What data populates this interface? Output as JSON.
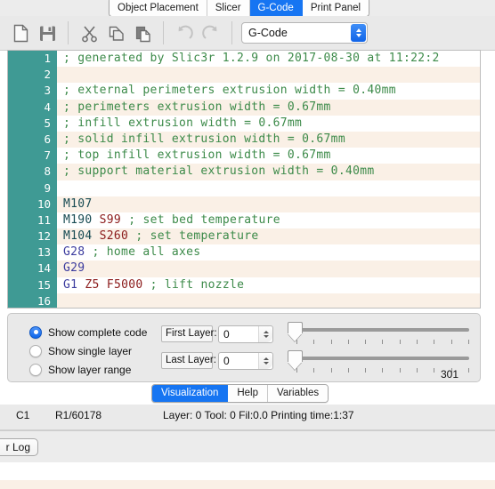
{
  "top_tabs": [
    {
      "label": "Object Placement",
      "active": false
    },
    {
      "label": "Slicer",
      "active": false
    },
    {
      "label": "G-Code",
      "active": true
    },
    {
      "label": "Print Panel",
      "active": false
    }
  ],
  "toolbar": {
    "icons": [
      {
        "name": "new-file-icon",
        "title": "New"
      },
      {
        "name": "save-icon",
        "title": "Save"
      },
      {
        "name": "cut-icon",
        "title": "Cut"
      },
      {
        "name": "copy-icon",
        "title": "Copy"
      },
      {
        "name": "paste-icon",
        "title": "Paste"
      },
      {
        "name": "undo-icon",
        "title": "Undo"
      },
      {
        "name": "redo-icon",
        "title": "Redo"
      }
    ],
    "combo_value": "G-Code",
    "combo_options": [
      "G-Code"
    ]
  },
  "editor": {
    "lines": [
      {
        "num": "1",
        "segments": [
          {
            "t": "; generated by Slic3r 1.2.9 on 2017-08-30 at 11:22:2",
            "c": "cmt"
          }
        ]
      },
      {
        "num": "2",
        "segments": []
      },
      {
        "num": "3",
        "segments": [
          {
            "t": "; external perimeters extrusion width = 0.40mm",
            "c": "cmt"
          }
        ]
      },
      {
        "num": "4",
        "segments": [
          {
            "t": "; perimeters extrusion width = 0.67mm",
            "c": "cmt"
          }
        ]
      },
      {
        "num": "5",
        "segments": [
          {
            "t": "; infill extrusion width = 0.67mm",
            "c": "cmt"
          }
        ]
      },
      {
        "num": "6",
        "segments": [
          {
            "t": "; solid infill extrusion width = 0.67mm",
            "c": "cmt"
          }
        ]
      },
      {
        "num": "7",
        "segments": [
          {
            "t": "; top infill extrusion width = 0.67mm",
            "c": "cmt"
          }
        ]
      },
      {
        "num": "8",
        "segments": [
          {
            "t": "; support material extrusion width = 0.40mm",
            "c": "cmt"
          }
        ]
      },
      {
        "num": "9",
        "segments": []
      },
      {
        "num": "10",
        "segments": [
          {
            "t": "M107",
            "c": "mcmd"
          }
        ]
      },
      {
        "num": "11",
        "segments": [
          {
            "t": "M190",
            "c": "mcmd"
          },
          {
            "t": " ",
            "c": "plain"
          },
          {
            "t": "S99",
            "c": "par"
          },
          {
            "t": " ",
            "c": "plain"
          },
          {
            "t": "; set bed temperature",
            "c": "cmt"
          }
        ]
      },
      {
        "num": "12",
        "segments": [
          {
            "t": "M104",
            "c": "mcmd"
          },
          {
            "t": " ",
            "c": "plain"
          },
          {
            "t": "S260",
            "c": "par"
          },
          {
            "t": " ",
            "c": "plain"
          },
          {
            "t": "; set temperature",
            "c": "cmt"
          }
        ]
      },
      {
        "num": "13",
        "segments": [
          {
            "t": "G28",
            "c": "cmd"
          },
          {
            "t": " ",
            "c": "plain"
          },
          {
            "t": "; home all axes",
            "c": "cmt"
          }
        ]
      },
      {
        "num": "14",
        "segments": [
          {
            "t": "G29",
            "c": "cmd"
          }
        ]
      },
      {
        "num": "15",
        "segments": [
          {
            "t": "G1",
            "c": "cmd"
          },
          {
            "t": " ",
            "c": "plain"
          },
          {
            "t": "Z5",
            "c": "par"
          },
          {
            "t": " ",
            "c": "plain"
          },
          {
            "t": "F5000",
            "c": "par"
          },
          {
            "t": " ",
            "c": "plain"
          },
          {
            "t": "; lift nozzle",
            "c": "cmt"
          }
        ]
      },
      {
        "num": "16",
        "segments": []
      }
    ]
  },
  "controls": {
    "radios": [
      {
        "label": "Show complete code",
        "selected": true
      },
      {
        "label": "Show single layer",
        "selected": false
      },
      {
        "label": "Show layer range",
        "selected": false
      }
    ],
    "fields": [
      {
        "label": "First Layer:",
        "value": "0"
      },
      {
        "label": "Last Layer:",
        "value": "0"
      }
    ],
    "slider_max_label": "301"
  },
  "bottom_tabs": [
    {
      "label": "Visualization",
      "active": true
    },
    {
      "label": "Help",
      "active": false
    },
    {
      "label": "Variables",
      "active": false
    }
  ],
  "status": {
    "column": "C1",
    "row": "R1/60178",
    "info": "Layer: 0 Tool: 0 Fil:0.0 Printing time:1:37"
  },
  "bottom_strip": {
    "log_button": "r Log"
  },
  "colors": {
    "accent_blue": "#1675f2",
    "gutter_teal": "#3f9a94",
    "alt_row": "#faf0e6",
    "comment_green": "#3c8a49",
    "param_red": "#8b1a1a",
    "gcmd_blue": "#3b3b9e",
    "mcmd_teal": "#174a52"
  }
}
